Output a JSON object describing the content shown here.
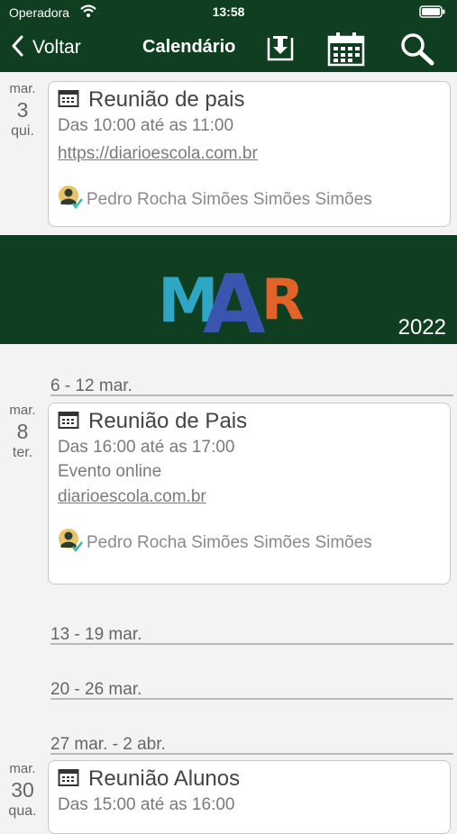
{
  "status": {
    "carrier": "Operadora",
    "time": "13:58"
  },
  "nav": {
    "back_label": "Voltar",
    "title": "Calendário"
  },
  "days": [
    {
      "month": "mar.",
      "day": "3",
      "weekday": "qui."
    },
    {
      "month": "mar.",
      "day": "8",
      "weekday": "ter."
    },
    {
      "month": "mar.",
      "day": "30",
      "weekday": "qua."
    }
  ],
  "events": [
    {
      "title": "Reunião de pais",
      "time": "Das 10:00 até as 11:00",
      "link": "https://diarioescola.com.br",
      "owner": "Pedro Rocha Simões Simões Simões"
    },
    {
      "title": "Reunião de Pais",
      "time": "Das 16:00 até as 17:00",
      "note": "Evento online",
      "link": "diarioescola.com.br",
      "owner": "Pedro Rocha Simões Simões Simões"
    },
    {
      "title": "Reunião Alunos",
      "time": "Das 15:00 até as 16:00"
    }
  ],
  "month_banner": {
    "letters": [
      "M",
      "A",
      "R"
    ],
    "year": "2022",
    "colors": [
      "#2fa6c4",
      "#3a55b0",
      "#e2632a"
    ]
  },
  "weeks": [
    "6 - 12 mar.",
    "13 - 19 mar.",
    "20 - 26 mar.",
    "27 mar. - 2 abr."
  ],
  "colors": {
    "header_bg": "#0f3f20",
    "page_bg": "#f3f3f3",
    "card_border": "#c8c8c8"
  }
}
